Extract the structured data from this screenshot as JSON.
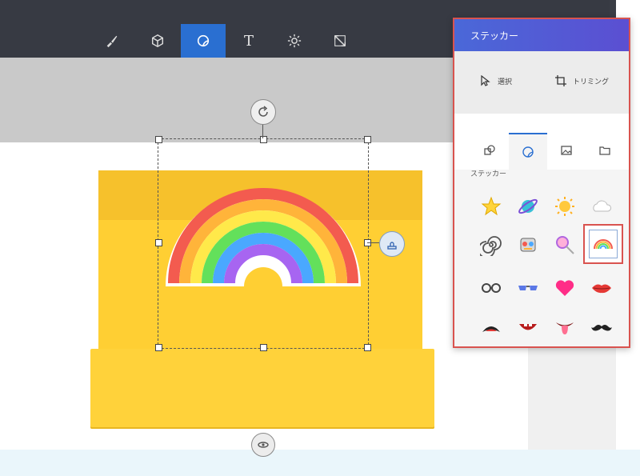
{
  "toolbar": {
    "tools": [
      {
        "name": "brushes",
        "icon": "brush-icon"
      },
      {
        "name": "3d-shapes",
        "icon": "cube-icon"
      },
      {
        "name": "stickers",
        "icon": "sticker-icon",
        "active": true
      },
      {
        "name": "text",
        "icon": "text-icon",
        "glyph": "T"
      },
      {
        "name": "effects",
        "icon": "sun-icon"
      },
      {
        "name": "canvas",
        "icon": "resize-icon"
      }
    ]
  },
  "colors": {
    "toolbar_bg": "#373a43",
    "accent": "#2a6fd1",
    "panel_header_start": "#4a68d8",
    "panel_header_end": "#5b4fd2",
    "highlight_border": "#d9534f",
    "banner_yellow": "#ffcf33"
  },
  "panel": {
    "title": "ステッカー",
    "select_label": "選択",
    "crop_label": "トリミング",
    "tabs": [
      {
        "icon": "shapes-icon"
      },
      {
        "icon": "sticker-icon",
        "active": true
      },
      {
        "icon": "image-icon"
      },
      {
        "icon": "folder-icon"
      }
    ],
    "section_label": "ステッカー",
    "stickers": [
      [
        "star-sticker",
        "planet-sticker",
        "sun-sticker",
        "cloud-sticker"
      ],
      [
        "spiral-sticker",
        "robot-sticker",
        "lollipop-sticker",
        "rainbow-sticker"
      ],
      [
        "glasses-sticker",
        "sunglasses-sticker",
        "heart-sticker",
        "lips-sticker"
      ],
      [
        "smile-sticker",
        "mouth-sticker",
        "tongue-sticker",
        "mustache-sticker"
      ]
    ],
    "selected_sticker": "rainbow-sticker"
  }
}
